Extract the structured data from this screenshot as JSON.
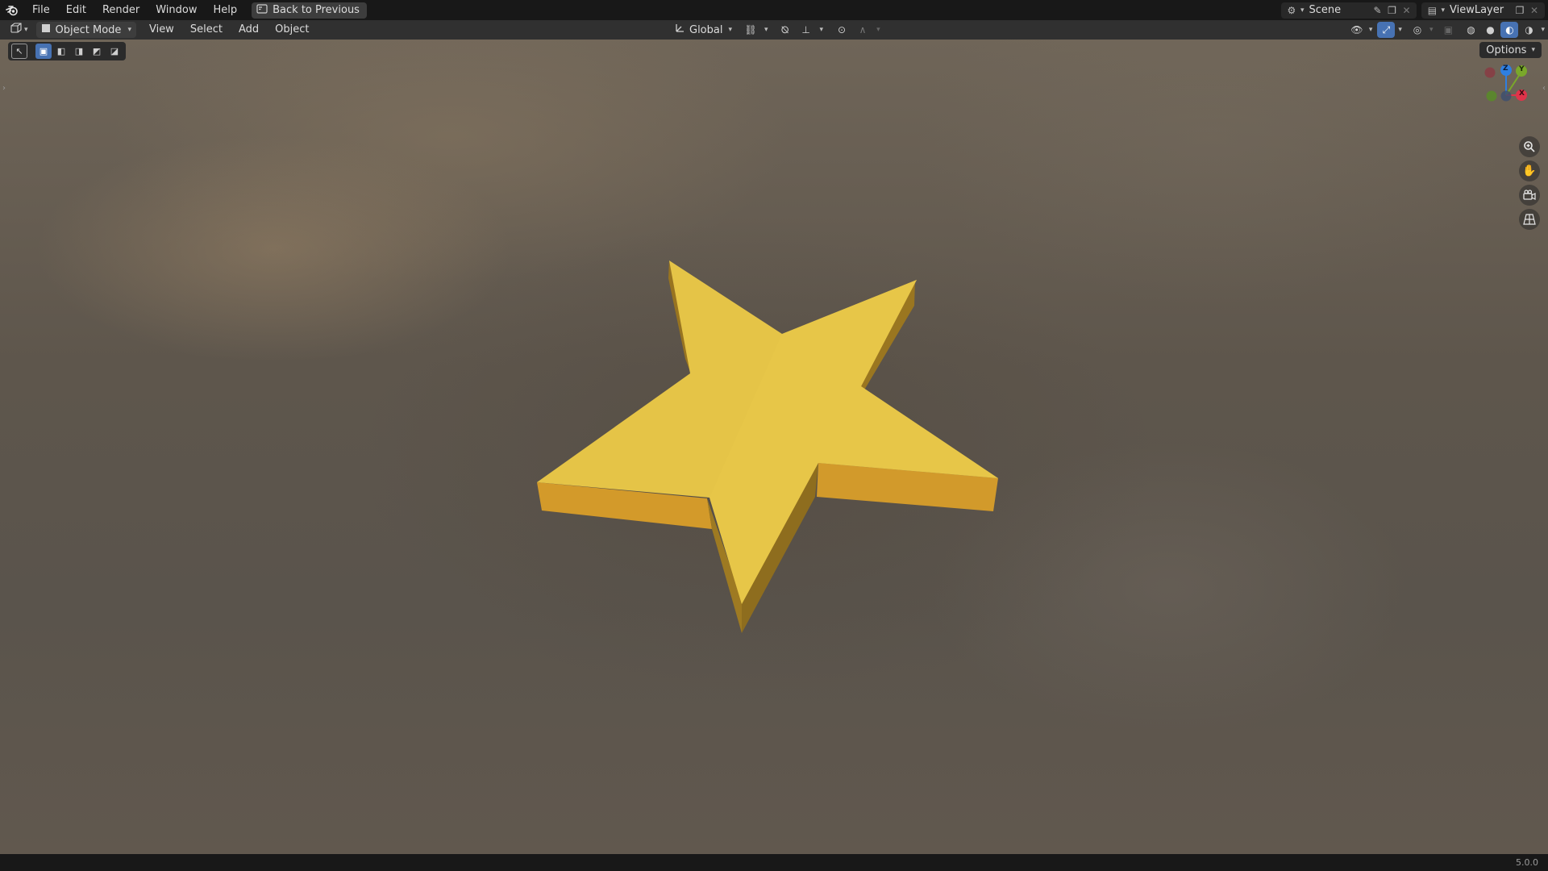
{
  "topbar": {
    "menus": [
      "File",
      "Edit",
      "Render",
      "Window",
      "Help"
    ],
    "back_button": "Back to Previous",
    "scene": "Scene",
    "view_layer": "ViewLayer"
  },
  "viewport_header": {
    "mode": "Object Mode",
    "menus": [
      "View",
      "Select",
      "Add",
      "Object"
    ],
    "orientation": "Global",
    "options": "Options"
  },
  "gizmo": {
    "axes": {
      "z": "Z",
      "y": "Y",
      "x": "X"
    },
    "colors": {
      "x": "#e0334a",
      "y": "#7aa82a",
      "z": "#2f7fe0"
    }
  },
  "icons": {
    "logo": "blender-logo-icon",
    "back": "back-to-previous-icon",
    "zoom": "zoom-icon",
    "pan": "hand-pan-icon",
    "camera": "camera-view-icon",
    "perspective": "perspective-grid-icon"
  },
  "scene_object": {
    "name": "star",
    "color": "#e6c448",
    "side_color": "#d6a22e"
  },
  "statusbar": {
    "version": "5.0.0"
  }
}
